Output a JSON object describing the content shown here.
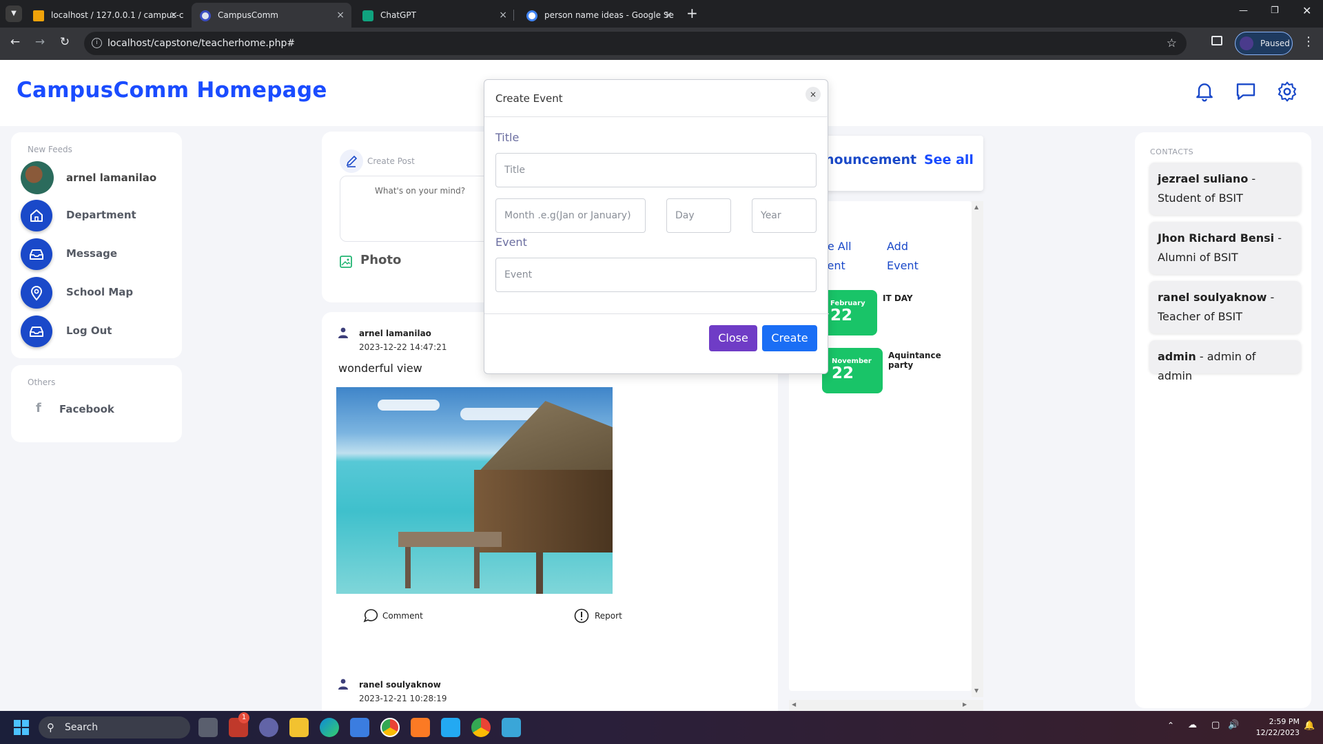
{
  "browser": {
    "tabs": [
      {
        "title": "localhost / 127.0.0.1 / campus-c",
        "close": "×"
      },
      {
        "title": "CampusComm",
        "close": "×"
      },
      {
        "title": "ChatGPT",
        "close": "×"
      },
      {
        "title": "person name ideas - Google Se",
        "close": "×"
      }
    ],
    "new_tab": "+",
    "url": "localhost/capstone/teacherhome.php#",
    "profile_status": "Paused"
  },
  "page": {
    "brand": "CampusComm Homepage",
    "sidebar": {
      "section_title": "New Feeds",
      "user_name": "arnel lamanilao",
      "items": [
        {
          "label": "Department",
          "icon": "home-icon"
        },
        {
          "label": "Message",
          "icon": "inbox-icon"
        },
        {
          "label": "School Map",
          "icon": "map-pin-icon"
        },
        {
          "label": "Log Out",
          "icon": "inbox-icon"
        }
      ],
      "others_title": "Others",
      "others": [
        {
          "label": "Facebook",
          "icon": "facebook-icon"
        }
      ]
    },
    "create_post": {
      "label": "Create Post",
      "placeholder": "What's on your mind?",
      "photo_label": "Photo"
    },
    "posts": [
      {
        "author": "arnel lamanilao",
        "date": "2023-12-22 14:47:21",
        "text": "wonderful view",
        "comment_label": "Comment",
        "report_label": "Report"
      },
      {
        "author": "ranel soulyaknow",
        "date": "2023-12-21 10:28:19"
      }
    ],
    "announcement": {
      "title": "nouncement",
      "see_all": "See all"
    },
    "events": {
      "see_all_line1": "ee All",
      "see_all_line2": "vent",
      "add_line1": "Add",
      "add_line2": "Event",
      "items": [
        {
          "month": "February",
          "day": "22",
          "name": "IT DAY"
        },
        {
          "month": "November",
          "day": "22",
          "name": "Aquintance party"
        }
      ]
    },
    "contacts": {
      "title": "CONTACTS",
      "items": [
        {
          "name": "jezrael suliano",
          "role": " - Student of BSIT"
        },
        {
          "name": "Jhon Richard Bensi",
          "role": " - Alumni of BSIT"
        },
        {
          "name": "ranel soulyaknow",
          "role": " - Teacher of BSIT"
        },
        {
          "name": "admin",
          "role": " - admin of admin"
        }
      ]
    }
  },
  "modal": {
    "title": "Create Event",
    "close_x": "×",
    "title_label": "Title",
    "title_placeholder": "Title",
    "month_placeholder": "Month .e.g(Jan or January)",
    "day_placeholder": "Day",
    "year_placeholder": "Year",
    "event_label": "Event",
    "event_placeholder": "Event",
    "close_button": "Close",
    "create_button": "Create"
  },
  "taskbar": {
    "search_label": "Search",
    "time": "2:59 PM",
    "date": "12/22/2023",
    "badge": "1"
  },
  "colors": {
    "brand": "#1a4cff",
    "nav_icon_bg": "#1a49c9",
    "event_green": "#19c468",
    "close_btn": "#6f3cc6",
    "create_btn": "#1a6ef5"
  }
}
